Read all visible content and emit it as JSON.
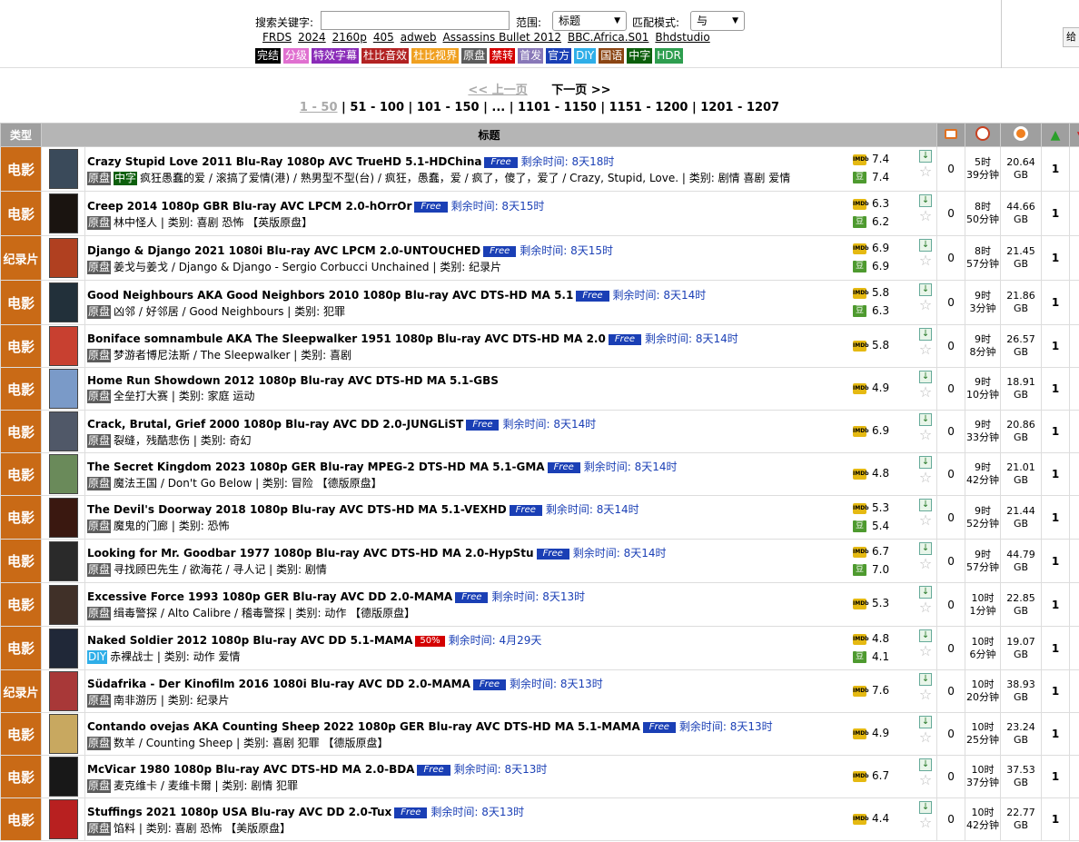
{
  "search": {
    "label": "搜索关键字:",
    "input_value": "",
    "scope_label": "范围:",
    "scope_value": "标题",
    "mode_label": "匹配模式:",
    "mode_value": "与",
    "give_label": "给",
    "keywords": [
      "FRDS",
      "2024",
      "2160p",
      "405",
      "adweb",
      "Assassins Bullet 2012",
      "BBC.Africa.S01",
      "Bhdstudio"
    ],
    "tags": [
      {
        "label": "完结",
        "color": "#000000"
      },
      {
        "label": "分级",
        "color": "#e070d0"
      },
      {
        "label": "特效字幕",
        "color": "#8a2bb8"
      },
      {
        "label": "杜比音效",
        "color": "#b22222"
      },
      {
        "label": "杜比视界",
        "color": "#f0a020"
      },
      {
        "label": "原盘",
        "color": "#5c5c5c"
      },
      {
        "label": "禁转",
        "color": "#d40000"
      },
      {
        "label": "首发",
        "color": "#8878b8"
      },
      {
        "label": "官方",
        "color": "#1a3fb5"
      },
      {
        "label": "DIY",
        "color": "#2faee8"
      },
      {
        "label": "国语",
        "color": "#8b4513"
      },
      {
        "label": "中字",
        "color": "#0c5f0c"
      },
      {
        "label": "HDR",
        "color": "#2e9e4f"
      }
    ]
  },
  "pager": {
    "prev": "<< 上一页",
    "next": "下一页 >>",
    "current": "1 - 50",
    "pages": [
      "51 - 100",
      "101 - 150",
      "...",
      "1101 - 1150",
      "1151 - 1200",
      "1201 - 1207"
    ]
  },
  "table": {
    "headers": {
      "type": "类型",
      "title": "标题"
    },
    "rows": [
      {
        "cat": "电影",
        "poster": "#3a4a5a",
        "title": "Crazy Stupid Love 2011 Blu-Ray 1080p AVC TrueHD 5.1-HDChina",
        "promo": "Free",
        "remain": "剩余时间: 8天18时",
        "tags": [
          "原盘",
          "中字"
        ],
        "sub": "疯狂愚蠢的爱 / 滚搞了爱情(港) / 熟男型不型(台) / 疯狂，愚蠢，爱 / 疯了，傻了，爱了 / Crazy, Stupid, Love. | 类别: 剧情 喜剧 爱情",
        "imdb": "7.4",
        "douban": "7.4",
        "comments": "0",
        "time": [
          "5时",
          "39分钟"
        ],
        "size": [
          "20.64",
          "GB"
        ],
        "seeders": "1"
      },
      {
        "cat": "电影",
        "poster": "#1a1410",
        "title": "Creep 2014 1080p GBR Blu-ray AVC LPCM 2.0-hOrrOr",
        "promo": "Free",
        "remain": "剩余时间: 8天15时",
        "tags": [
          "原盘"
        ],
        "sub": "林中怪人 | 类别: 喜剧 恐怖 【英版原盘】",
        "imdb": "6.3",
        "douban": "6.2",
        "comments": "0",
        "time": [
          "8时",
          "50分钟"
        ],
        "size": [
          "44.66",
          "GB"
        ],
        "seeders": "1"
      },
      {
        "cat": "纪录片",
        "poster": "#b04020",
        "title": "Django & Django 2021 1080i Blu-ray AVC LPCM 2.0-UNTOUCHED",
        "promo": "Free",
        "remain": "剩余时间: 8天15时",
        "tags": [
          "原盘"
        ],
        "sub": "姜戈与姜戈 / Django & Django - Sergio Corbucci Unchained | 类别: 纪录片",
        "imdb": "6.9",
        "douban": "6.9",
        "comments": "0",
        "time": [
          "8时",
          "57分钟"
        ],
        "size": [
          "21.45",
          "GB"
        ],
        "seeders": "1"
      },
      {
        "cat": "电影",
        "poster": "#22303a",
        "title": "Good Neighbours AKA Good Neighbors 2010 1080p Blu-ray AVC DTS-HD MA 5.1",
        "promo": "Free",
        "remain": "剩余时间: 8天14时",
        "tags": [
          "原盘"
        ],
        "sub": "凶邻 / 好邻居 / Good Neighbours | 类别: 犯罪",
        "imdb": "5.8",
        "douban": "6.3",
        "comments": "0",
        "time": [
          "9时",
          "3分钟"
        ],
        "size": [
          "21.86",
          "GB"
        ],
        "seeders": "1"
      },
      {
        "cat": "电影",
        "poster": "#c84030",
        "title": "Boniface somnambule AKA The Sleepwalker 1951 1080p Blu-ray AVC DTS-HD MA 2.0",
        "promo": "Free",
        "remain": "剩余时间: 8天14时",
        "tags": [
          "原盘"
        ],
        "sub": "梦游者博尼法斯 / The Sleepwalker | 类别: 喜剧",
        "imdb": "5.8",
        "douban": "",
        "comments": "0",
        "time": [
          "9时",
          "8分钟"
        ],
        "size": [
          "26.57",
          "GB"
        ],
        "seeders": "1"
      },
      {
        "cat": "电影",
        "poster": "#7a9ac8",
        "title": "Home Run Showdown 2012 1080p Blu-ray AVC DTS-HD MA 5.1-GBS",
        "promo": "",
        "remain": "",
        "tags": [
          "原盘"
        ],
        "sub": "全垒打大赛 | 类别: 家庭 运动",
        "imdb": "4.9",
        "douban": "",
        "comments": "0",
        "time": [
          "9时",
          "10分钟"
        ],
        "size": [
          "18.91",
          "GB"
        ],
        "seeders": "1"
      },
      {
        "cat": "电影",
        "poster": "#505868",
        "title": "Crack, Brutal, Grief 2000 1080p Blu-ray AVC DD 2.0-JUNGLiST",
        "promo": "Free",
        "remain": "剩余时间: 8天14时",
        "tags": [
          "原盘"
        ],
        "sub": "裂缝，残酷悲伤 | 类别: 奇幻",
        "imdb": "6.9",
        "douban": "",
        "comments": "0",
        "time": [
          "9时",
          "33分钟"
        ],
        "size": [
          "20.86",
          "GB"
        ],
        "seeders": "1"
      },
      {
        "cat": "电影",
        "poster": "#6a8a5a",
        "title": "The Secret Kingdom 2023 1080p GER Blu-ray MPEG-2 DTS-HD MA 5.1-GMA",
        "promo": "Free",
        "remain": "剩余时间: 8天14时",
        "tags": [
          "原盘"
        ],
        "sub": "魔法王国 / Don't Go Below | 类别: 冒险 【德版原盘】",
        "imdb": "4.8",
        "douban": "",
        "comments": "0",
        "time": [
          "9时",
          "42分钟"
        ],
        "size": [
          "21.01",
          "GB"
        ],
        "seeders": "1"
      },
      {
        "cat": "电影",
        "poster": "#3a1810",
        "title": "The Devil's Doorway 2018 1080p Blu-ray AVC DTS-HD MA 5.1-VEXHD",
        "promo": "Free",
        "remain": "剩余时间: 8天14时",
        "tags": [
          "原盘"
        ],
        "sub": "魔鬼的门廊 | 类别: 恐怖",
        "imdb": "5.3",
        "douban": "5.4",
        "comments": "0",
        "time": [
          "9时",
          "52分钟"
        ],
        "size": [
          "21.44",
          "GB"
        ],
        "seeders": "1"
      },
      {
        "cat": "电影",
        "poster": "#2a2a2a",
        "title": "Looking for Mr. Goodbar 1977 1080p Blu-ray AVC DTS-HD MA 2.0-HypStu",
        "promo": "Free",
        "remain": "剩余时间: 8天14时",
        "tags": [
          "原盘"
        ],
        "sub": "寻找顾巴先生 / 欲海花 / 寻人记 | 类别: 剧情",
        "imdb": "6.7",
        "douban": "7.0",
        "comments": "0",
        "time": [
          "9时",
          "57分钟"
        ],
        "size": [
          "44.79",
          "GB"
        ],
        "seeders": "1"
      },
      {
        "cat": "电影",
        "poster": "#403028",
        "title": "Excessive Force 1993 1080p GER Blu-ray AVC DD 2.0-MAMA",
        "promo": "Free",
        "remain": "剩余时间: 8天13时",
        "tags": [
          "原盘"
        ],
        "sub": "缉毒警探 / Alto Calibre / 稽毒警探 | 类别: 动作 【德版原盘】",
        "imdb": "5.3",
        "douban": "",
        "comments": "0",
        "time": [
          "10时",
          "1分钟"
        ],
        "size": [
          "22.85",
          "GB"
        ],
        "seeders": "1"
      },
      {
        "cat": "电影",
        "poster": "#202838",
        "title": "Naked Soldier 2012 1080p Blu-ray AVC DD 5.1-MAMA",
        "promo": "50%",
        "remain": "剩余时间: 4月29天",
        "tags": [
          "DIY"
        ],
        "sub": "赤裸战士 | 类别: 动作 爱情",
        "imdb": "4.8",
        "douban": "4.1",
        "comments": "0",
        "time": [
          "10时",
          "6分钟"
        ],
        "size": [
          "19.07",
          "GB"
        ],
        "seeders": "1"
      },
      {
        "cat": "纪录片",
        "poster": "#a83838",
        "title": "Südafrika - Der Kinofilm 2016 1080i Blu-ray AVC DD 2.0-MAMA",
        "promo": "Free",
        "remain": "剩余时间: 8天13时",
        "tags": [
          "原盘"
        ],
        "sub": "南非游历 | 类别: 纪录片",
        "imdb": "7.6",
        "douban": "",
        "comments": "0",
        "time": [
          "10时",
          "20分钟"
        ],
        "size": [
          "38.93",
          "GB"
        ],
        "seeders": "1"
      },
      {
        "cat": "电影",
        "poster": "#c8a860",
        "title": "Contando ovejas AKA Counting Sheep 2022 1080p GER Blu-ray AVC DTS-HD MA 5.1-MAMA",
        "promo": "Free",
        "remain": "剩余时间: 8天13时",
        "tags": [
          "原盘"
        ],
        "sub": "数羊 / Counting Sheep | 类别: 喜剧 犯罪 【德版原盘】",
        "imdb": "4.9",
        "douban": "",
        "comments": "0",
        "time": [
          "10时",
          "25分钟"
        ],
        "size": [
          "23.24",
          "GB"
        ],
        "seeders": "1"
      },
      {
        "cat": "电影",
        "poster": "#181818",
        "title": "McVicar 1980 1080p Blu-ray AVC DTS-HD MA 2.0-BDA",
        "promo": "Free",
        "remain": "剩余时间: 8天13时",
        "tags": [
          "原盘"
        ],
        "sub": "麦克维卡 / 麦维卡爾 | 类别: 剧情 犯罪",
        "imdb": "6.7",
        "douban": "",
        "comments": "0",
        "time": [
          "10时",
          "37分钟"
        ],
        "size": [
          "37.53",
          "GB"
        ],
        "seeders": "1"
      },
      {
        "cat": "电影",
        "poster": "#b82020",
        "title": "Stuffings 2021 1080p USA Blu-ray AVC DD 2.0-Tux",
        "promo": "Free",
        "remain": "剩余时间: 8天13时",
        "tags": [
          "原盘"
        ],
        "sub": "馅料 | 类别: 喜剧 恐怖 【美版原盘】",
        "imdb": "4.4",
        "douban": "",
        "comments": "0",
        "time": [
          "10时",
          "42分钟"
        ],
        "size": [
          "22.77",
          "GB"
        ],
        "seeders": "1"
      }
    ]
  }
}
